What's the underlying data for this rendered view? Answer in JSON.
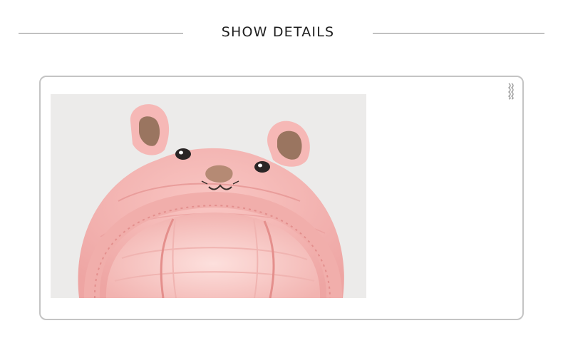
{
  "section": {
    "heading": "SHOW DETAILS"
  },
  "photo": {
    "subject": "pink-bear-hood-closeup",
    "colors": {
      "background": "#ecebea",
      "fabric": "#f6b8b6",
      "fabric_shadow": "#e99d9b",
      "lining": "#fbd0cd",
      "ear_inner": "#9a7560",
      "nose": "#b58a74",
      "eye": "#2a2525"
    }
  },
  "decor": {
    "frame_color": "#c4c4c4",
    "rule_color": "#8a8a8a"
  }
}
